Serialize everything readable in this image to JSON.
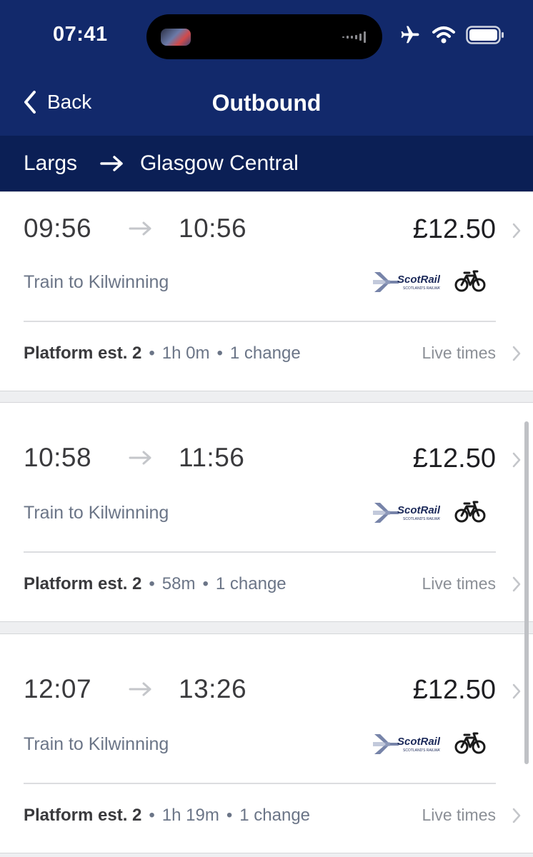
{
  "status": {
    "time": "07:41"
  },
  "nav": {
    "back_label": "Back",
    "title": "Outbound"
  },
  "route": {
    "from": "Largs",
    "to": "Glasgow Central"
  },
  "colors": {
    "header": "#12296b",
    "route_bar": "#0b1f55",
    "accent_text": "#6b7587"
  },
  "journeys": [
    {
      "depart": "09:56",
      "arrive": "10:56",
      "price": "£12.50",
      "destination": "Train to Kilwinning",
      "platform": "Platform est. 2",
      "duration": "1h 0m",
      "changes": "1 change",
      "live": "Live times",
      "operator": "ScotRail",
      "operator_tag": "SCOTLAND'S RAILWAY",
      "bike_icon": "bicycle-icon"
    },
    {
      "depart": "10:58",
      "arrive": "11:56",
      "price": "£12.50",
      "destination": "Train to Kilwinning",
      "platform": "Platform est. 2",
      "duration": "58m",
      "changes": "1 change",
      "live": "Live times",
      "operator": "ScotRail",
      "operator_tag": "SCOTLAND'S RAILWAY",
      "bike_icon": "bicycle-icon"
    },
    {
      "depart": "12:07",
      "arrive": "13:26",
      "price": "£12.50",
      "destination": "Train to Kilwinning",
      "platform": "Platform est. 2",
      "duration": "1h 19m",
      "changes": "1 change",
      "live": "Live times",
      "operator": "ScotRail",
      "operator_tag": "SCOTLAND'S RAILWAY",
      "bike_icon": "bicycle-icon"
    }
  ]
}
